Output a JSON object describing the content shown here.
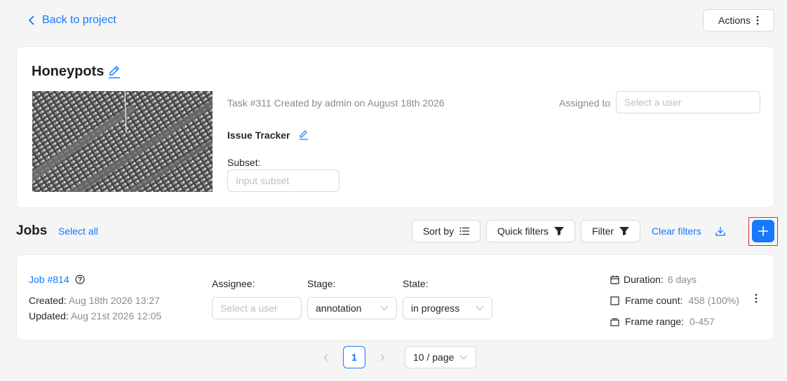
{
  "nav": {
    "back_label": "Back to project"
  },
  "header": {
    "actions_label": "Actions"
  },
  "task": {
    "title": "Honeypots",
    "meta": "Task #311 Created by admin on August 18th 2026",
    "assigned_label": "Assigned to",
    "assigned_placeholder": "Select a user",
    "issue_tracker_label": "Issue Tracker",
    "subset_label": "Subset:",
    "subset_placeholder": "Input subset"
  },
  "jobs_toolbar": {
    "title": "Jobs",
    "select_all": "Select all",
    "sort_by": "Sort by",
    "quick_filters": "Quick filters",
    "filter": "Filter",
    "clear_filters": "Clear filters"
  },
  "job": {
    "name": "Job #814",
    "created_label": "Created:",
    "created_value": "Aug 18th 2026 13:27",
    "updated_label": "Updated:",
    "updated_value": "Aug 21st 2026 12:05",
    "assignee_label": "Assignee:",
    "assignee_placeholder": "Select a user",
    "stage_label": "Stage:",
    "stage_value": "annotation",
    "state_label": "State:",
    "state_value": "in progress",
    "duration_label": "Duration:",
    "duration_value": "6 days",
    "frame_count_label": "Frame count:",
    "frame_count_value": "458 (100%)",
    "frame_range_label": "Frame range:",
    "frame_range_value": "0-457"
  },
  "pagination": {
    "current_page": "1",
    "page_size": "10 / page"
  },
  "colors": {
    "accent": "#1677ff",
    "highlight_box": "#e0282e",
    "background": "#f5f5f5"
  }
}
